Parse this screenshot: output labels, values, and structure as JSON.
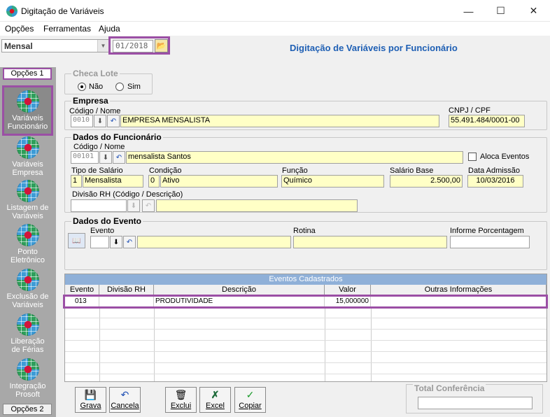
{
  "window": {
    "title": "Digitação de Variáveis"
  },
  "menu": {
    "items": [
      "Opções",
      "Ferramentas",
      "Ajuda"
    ]
  },
  "toolbar": {
    "period_type": "Mensal",
    "period": "01/2018",
    "form_title": "Digitação de Variáveis por Funcionário"
  },
  "sidebar": {
    "tab_top": "Opções 1",
    "tab_bottom": "Opções 2",
    "items": [
      {
        "label": "Variáveis\nFuncionário"
      },
      {
        "label": "Variáveis\nEmpresa"
      },
      {
        "label": "Listagem de\nVariáveis"
      },
      {
        "label": "Ponto\nEletrônico"
      },
      {
        "label": "Exclusão de\nVariáveis"
      },
      {
        "label": "Liberação\nde Férias"
      },
      {
        "label": "Integração\nProsoft"
      }
    ]
  },
  "checa_lote": {
    "title": "Checa Lote",
    "opt_nao": "Não",
    "opt_sim": "Sim",
    "selected": "Não"
  },
  "empresa": {
    "title": "Empresa",
    "code_label": "Código / Nome",
    "code": "0010",
    "name": "EMPRESA MENSALISTA",
    "cnpj_label": "CNPJ / CPF",
    "cnpj": "55.491.484/0001-00"
  },
  "funcionario": {
    "title": "Dados do Funcionário",
    "code_label": "Código / Nome",
    "code": "00101",
    "name": "mensalista Santos",
    "aloca_label": "Aloca Eventos",
    "tipo_label": "Tipo de Salário",
    "tipo_code": "1",
    "tipo": "Mensalista",
    "cond_label": "Condição",
    "cond_code": "0",
    "cond": "Ativo",
    "funcao_label": "Função",
    "funcao": "Químico",
    "salario_label": "Salário Base",
    "salario": "2.500,00",
    "admissao_label": "Data Admissão",
    "admissao": "10/03/2016",
    "divisao_label": "Divisão RH (Código / Descrição)"
  },
  "evento": {
    "title": "Dados do Evento",
    "evento_label": "Evento",
    "rotina_label": "Rotina",
    "porcentagem_label": "Informe Porcentagem"
  },
  "grid": {
    "caption": "Eventos Cadastrados",
    "columns": [
      "Evento",
      "Divisão RH",
      "Descrição",
      "Valor",
      "Outras Informações"
    ],
    "rows": [
      {
        "evento": "013",
        "divisao": "",
        "descricao": "PRODUTIVIDADE",
        "valor": "15,000000",
        "outras": ""
      }
    ]
  },
  "buttons": {
    "grava": "Grava",
    "cancela": "Cancela",
    "exclui": "Exclui",
    "excel": "Excel",
    "copiar": "Copiar"
  },
  "total": {
    "title": "Total Conferência"
  }
}
